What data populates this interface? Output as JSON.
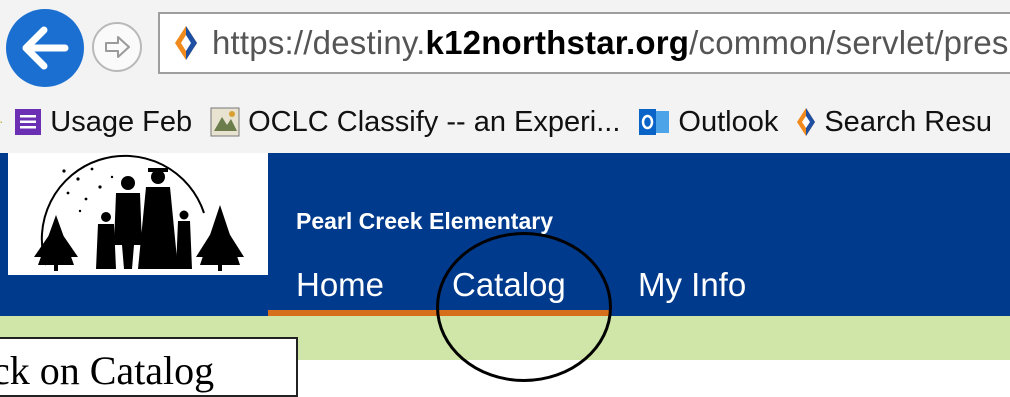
{
  "browser": {
    "address": {
      "prefix": "https://destiny.",
      "host": "k12northstar.org",
      "path": "/common/servlet/presenthomef"
    },
    "favorites": [
      {
        "icon": "usage-feb-icon",
        "label": "Usage Feb"
      },
      {
        "icon": "oclc-icon",
        "label": "OCLC Classify -- an Experi..."
      },
      {
        "icon": "outlook-icon",
        "label": "Outlook"
      },
      {
        "icon": "destiny-icon",
        "label": "Search Resu"
      }
    ]
  },
  "page": {
    "school_name": "Pearl Creek Elementary",
    "tabs": [
      {
        "label": "Home"
      },
      {
        "label": "Catalog"
      },
      {
        "label": "My Info"
      }
    ]
  },
  "annotation": {
    "text": "ck on Catalog"
  },
  "colors": {
    "header_blue": "#003a8c",
    "tab_underline": "#d56f1c",
    "band_green": "#cfe6a8",
    "back_button_blue": "#1a6fd1"
  }
}
